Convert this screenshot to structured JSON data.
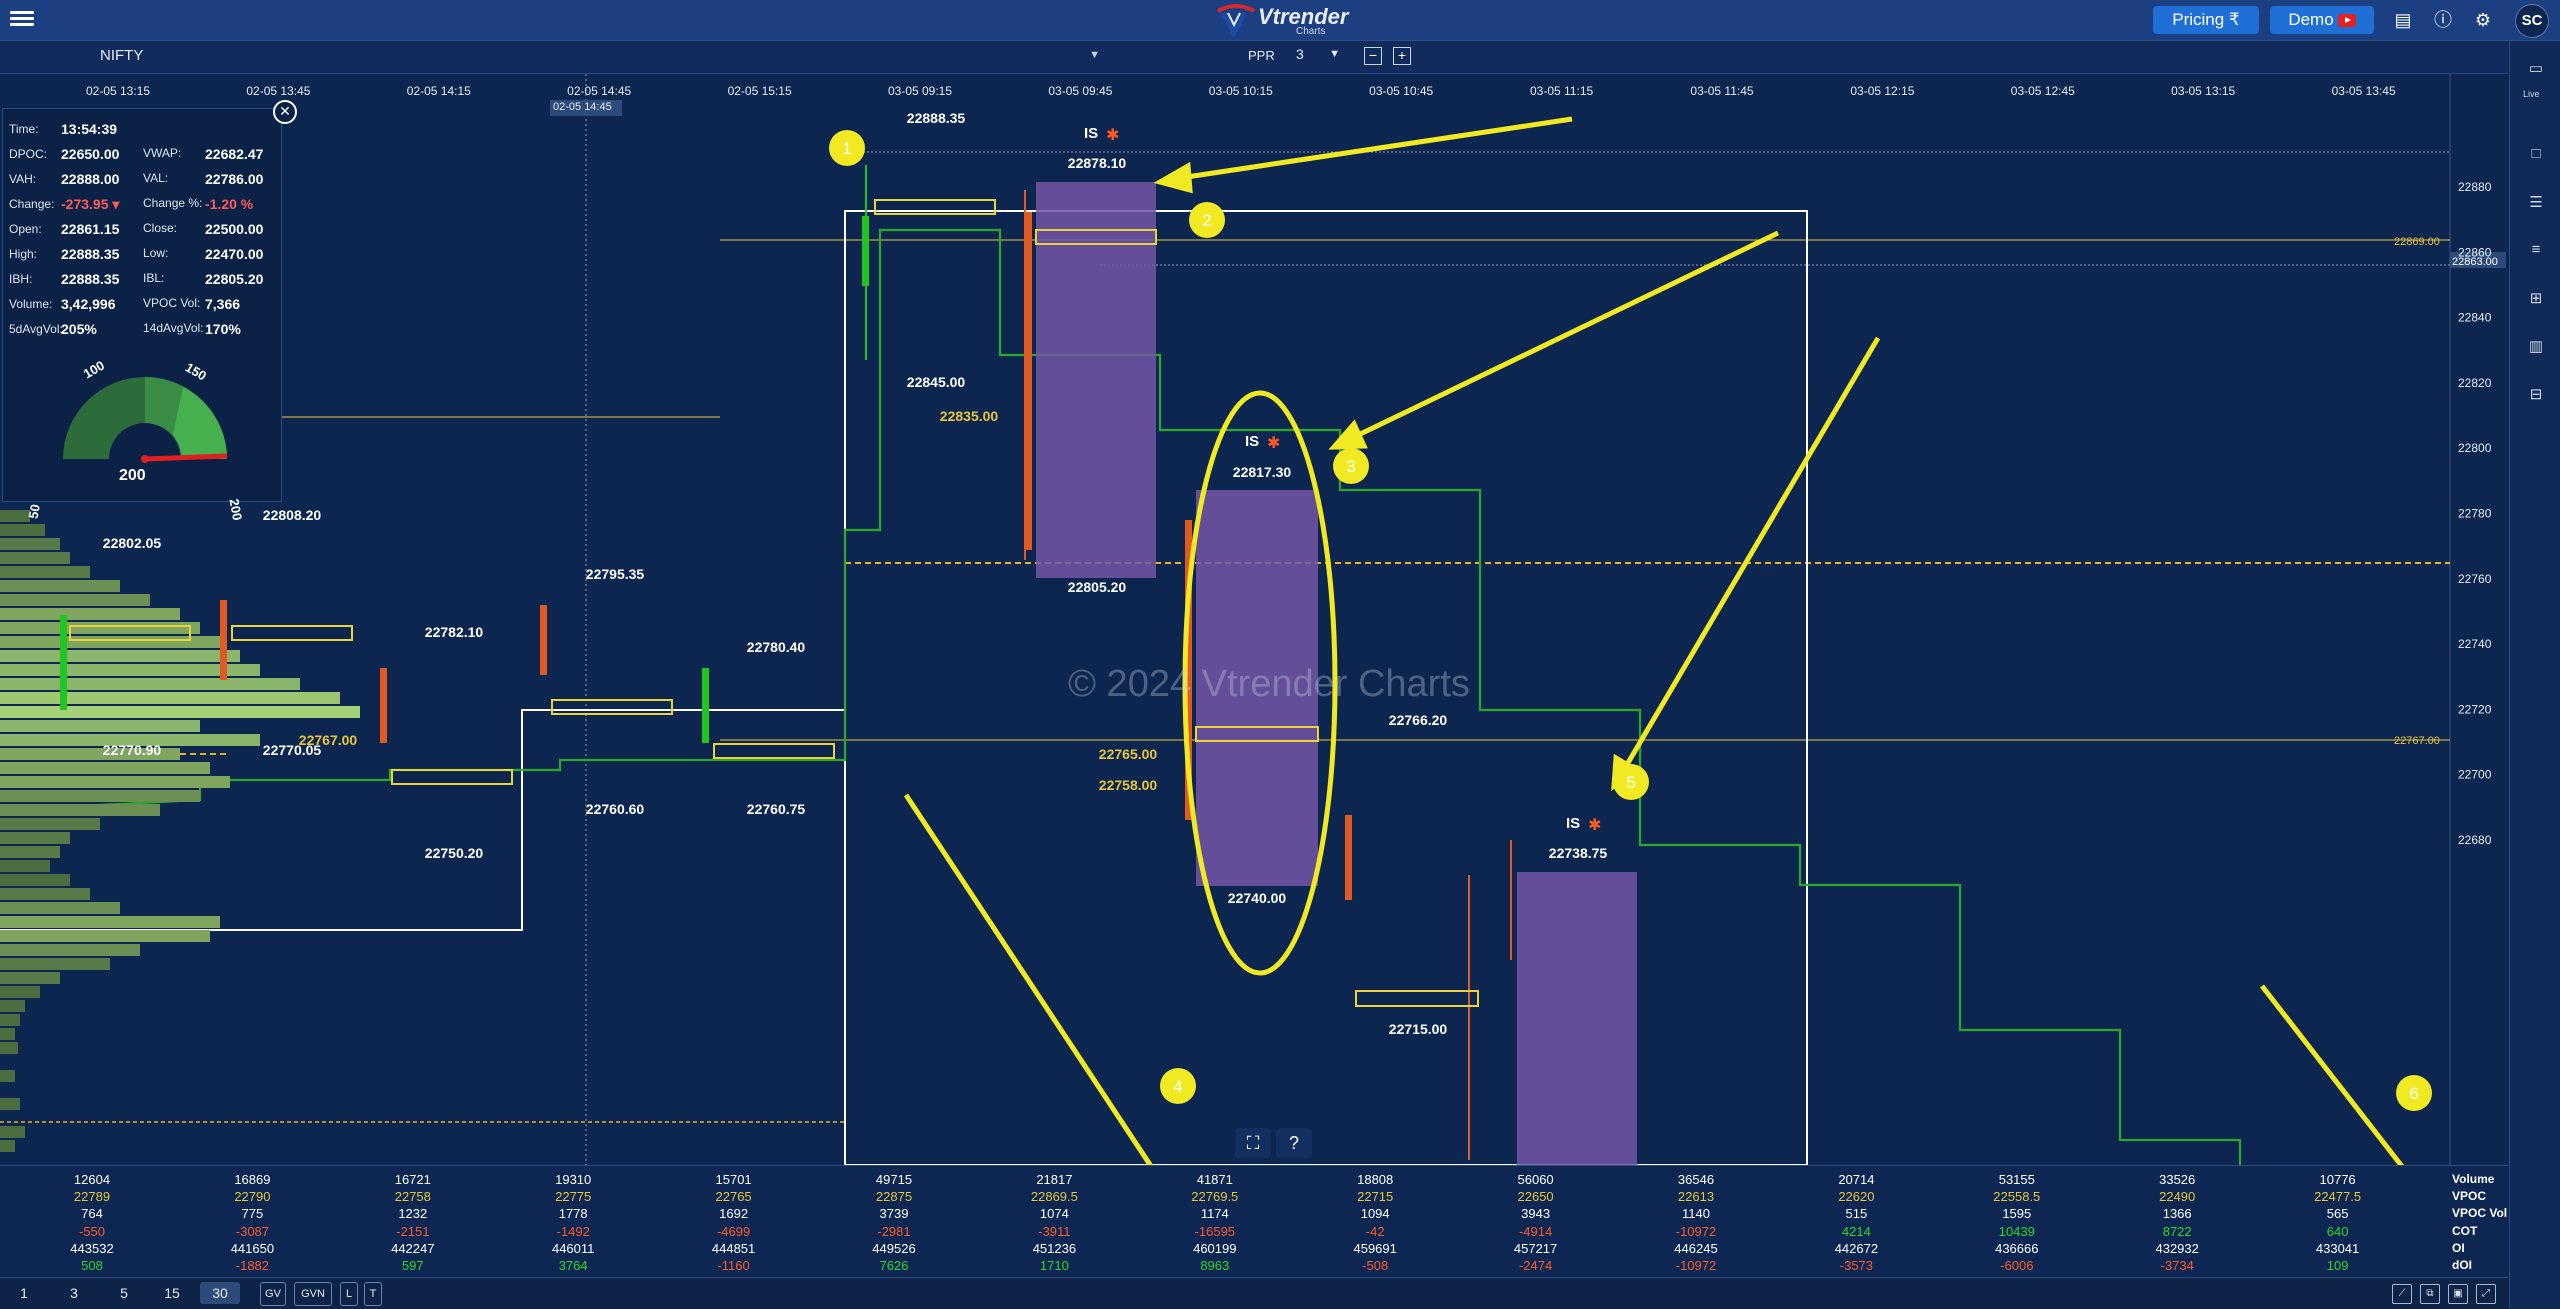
{
  "app": {
    "name": "Vtrender",
    "sub": "Charts"
  },
  "topbar": {
    "pricing_label": "Pricing ₹",
    "demo_label": "Demo",
    "avatar_initials": "SC"
  },
  "toolbar": {
    "symbol": "NIFTY",
    "ppr_label": "PPR",
    "ppr_value": "3",
    "minus": "−",
    "plus": "+"
  },
  "right_sidebar": {
    "live_label": "Live"
  },
  "info_panel": {
    "rows": [
      {
        "k1": "Time:",
        "v1": "13:54:39"
      },
      {
        "k1": "DPOC:",
        "v1": "22650.00",
        "k2": "VWAP:",
        "v2": "22682.47"
      },
      {
        "k1": "VAH:",
        "v1": "22888.00",
        "k2": "VAL:",
        "v2": "22786.00"
      },
      {
        "k1": "Change:",
        "v1": "-273.95 ▾",
        "k2": "Change %:",
        "v2": "-1.20 %"
      },
      {
        "k1": "Open:",
        "v1": "22861.15",
        "k2": "Close:",
        "v2": "22500.00"
      },
      {
        "k1": "High:",
        "v1": "22888.35",
        "k2": "Low:",
        "v2": "22470.00"
      },
      {
        "k1": "IBH:",
        "v1": "22888.35",
        "k2": "IBL:",
        "v2": "22805.20"
      },
      {
        "k1": "Volume:",
        "v1": "3,42,996",
        "k2": "VPOC Vol:",
        "v2": "7,366"
      },
      {
        "k1": "5dAvgVol:",
        "v1": "205%",
        "k2": "14dAvgVol:",
        "v2": "170%"
      }
    ],
    "gauge_ticks": [
      "50",
      "100",
      "150",
      "200"
    ],
    "gauge_value": "200",
    "gauge_level": 200
  },
  "time_axis": [
    "02-05 13:15",
    "02-05 13:45",
    "02-05 14:15",
    "02-05 14:45",
    "02-05 15:15",
    "03-05 09:15",
    "03-05 09:45",
    "03-05 10:15",
    "03-05 10:45",
    "03-05 11:15",
    "03-05 11:45",
    "03-05 12:15",
    "03-05 12:45",
    "03-05 13:15",
    "03-05 13:45"
  ],
  "crosshair_time": "02-05 14:45",
  "price_axis": [
    "22880",
    "22860",
    "22840",
    "22820",
    "22800",
    "22780",
    "22760",
    "22740",
    "22720",
    "22700",
    "22680"
  ],
  "level_tags": [
    "22869.00",
    "22863.00",
    "22767.00"
  ],
  "chart_labels": {
    "p1": "22888.35",
    "p2": "22878.10",
    "p3": "22845.00",
    "p4": "22835.00",
    "p5": "22805.20",
    "p6": "22817.30",
    "p7": "22740.00",
    "p8": "22766.20",
    "p9": "22715.00",
    "p10": "22738.75",
    "p11": "22802.05",
    "p12": "22808.20",
    "p13": "22795.35",
    "p14": "22782.10",
    "p15": "22780.40",
    "p16": "22770.90",
    "p17": "22770.05",
    "p18": "22767.00",
    "p19": "22760.60",
    "p20": "22760.75",
    "p21": "22750.20",
    "p22": "22765.00",
    "p23": "22758.00",
    "is_label": "IS"
  },
  "annotations": [
    "1",
    "2",
    "3",
    "4",
    "5",
    "6"
  ],
  "watermark": "© 2024 Vtrender Charts",
  "bottom_stats": {
    "labels": [
      "Volume",
      "VPOC",
      "VPOC Vol",
      "COT",
      "OI",
      "dOI"
    ],
    "columns": [
      [
        "12604",
        "22789",
        "764",
        "-550",
        "443532",
        "508"
      ],
      [
        "16869",
        "22790",
        "775",
        "-3087",
        "441650",
        "-1882"
      ],
      [
        "16721",
        "22758",
        "1232",
        "-2151",
        "442247",
        "597"
      ],
      [
        "19310",
        "22775",
        "1778",
        "-1492",
        "446011",
        "3764"
      ],
      [
        "15701",
        "22765",
        "1692",
        "-4699",
        "444851",
        "-1160"
      ],
      [
        "49715",
        "22875",
        "3739",
        "-2981",
        "449526",
        "7626"
      ],
      [
        "21817",
        "22869.5",
        "1074",
        "-3911",
        "451236",
        "1710"
      ],
      [
        "41871",
        "22769.5",
        "1174",
        "-16595",
        "460199",
        "8963"
      ],
      [
        "18808",
        "22715",
        "1094",
        "-42",
        "459691",
        "-508"
      ],
      [
        "56060",
        "22650",
        "3943",
        "-4914",
        "457217",
        "-2474"
      ],
      [
        "36546",
        "22613",
        "1140",
        "-10972",
        "446245",
        "-10972"
      ],
      [
        "20714",
        "22620",
        "515",
        "4214",
        "442672",
        "-3573"
      ],
      [
        "53155",
        "22558.5",
        "1595",
        "10439",
        "436666",
        "-6006"
      ],
      [
        "33526",
        "22490",
        "1366",
        "8722",
        "432932",
        "-3734"
      ],
      [
        "10776",
        "22477.5",
        "565",
        "640",
        "433041",
        "109"
      ]
    ]
  },
  "timeframes": [
    "1",
    "3",
    "5",
    "15",
    "30"
  ],
  "active_timeframe": "30",
  "toggles": [
    "GV",
    "GVN",
    "L",
    "T"
  ]
}
